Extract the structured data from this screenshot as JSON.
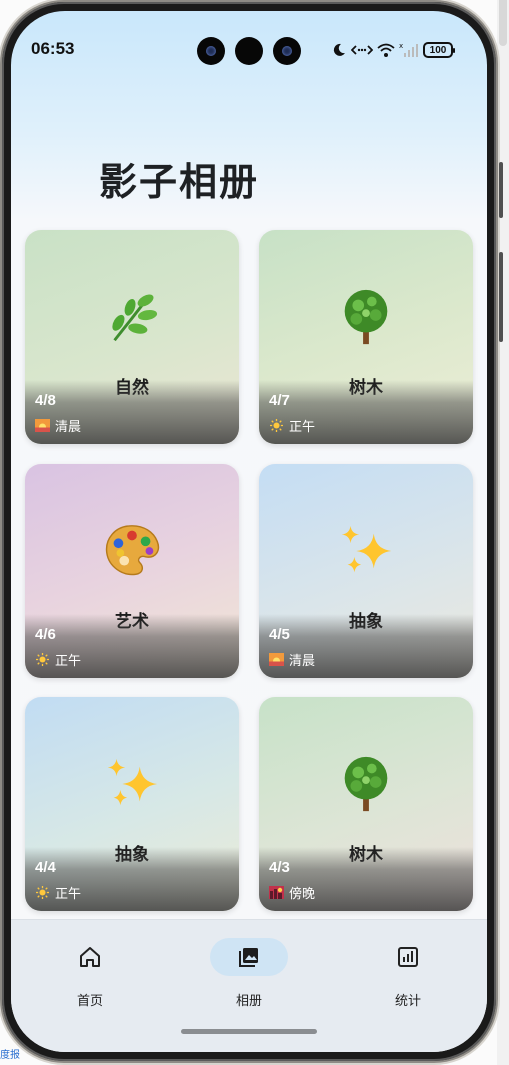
{
  "status_bar": {
    "time": "06:53",
    "battery": "100"
  },
  "page": {
    "title": "影子相册"
  },
  "albums": [
    {
      "name": "自然",
      "date": "4/8",
      "time_of_day": "清晨",
      "art": "herb-icon",
      "tod_icon": "sunrise-icon"
    },
    {
      "name": "树木",
      "date": "4/7",
      "time_of_day": "正午",
      "art": "tree-icon",
      "tod_icon": "sun-icon"
    },
    {
      "name": "艺术",
      "date": "4/6",
      "time_of_day": "正午",
      "art": "palette-icon",
      "tod_icon": "sun-icon"
    },
    {
      "name": "抽象",
      "date": "4/5",
      "time_of_day": "清晨",
      "art": "sparkles-icon",
      "tod_icon": "sunrise-icon"
    },
    {
      "name": "抽象",
      "date": "4/4",
      "time_of_day": "正午",
      "art": "sparkles-icon",
      "tod_icon": "sun-icon"
    },
    {
      "name": "树木",
      "date": "4/3",
      "time_of_day": "傍晚",
      "art": "tree-icon",
      "tod_icon": "city-dusk-icon"
    }
  ],
  "tabs": [
    {
      "label": "首页",
      "icon": "home-icon",
      "active": false
    },
    {
      "label": "相册",
      "icon": "gallery-icon",
      "active": true
    },
    {
      "label": "统计",
      "icon": "stats-icon",
      "active": false
    }
  ],
  "edge_text": "度报",
  "colors": {
    "active_tab_pill": "#cfe4f4",
    "tab_bar_bg": "#e6ebf1"
  }
}
